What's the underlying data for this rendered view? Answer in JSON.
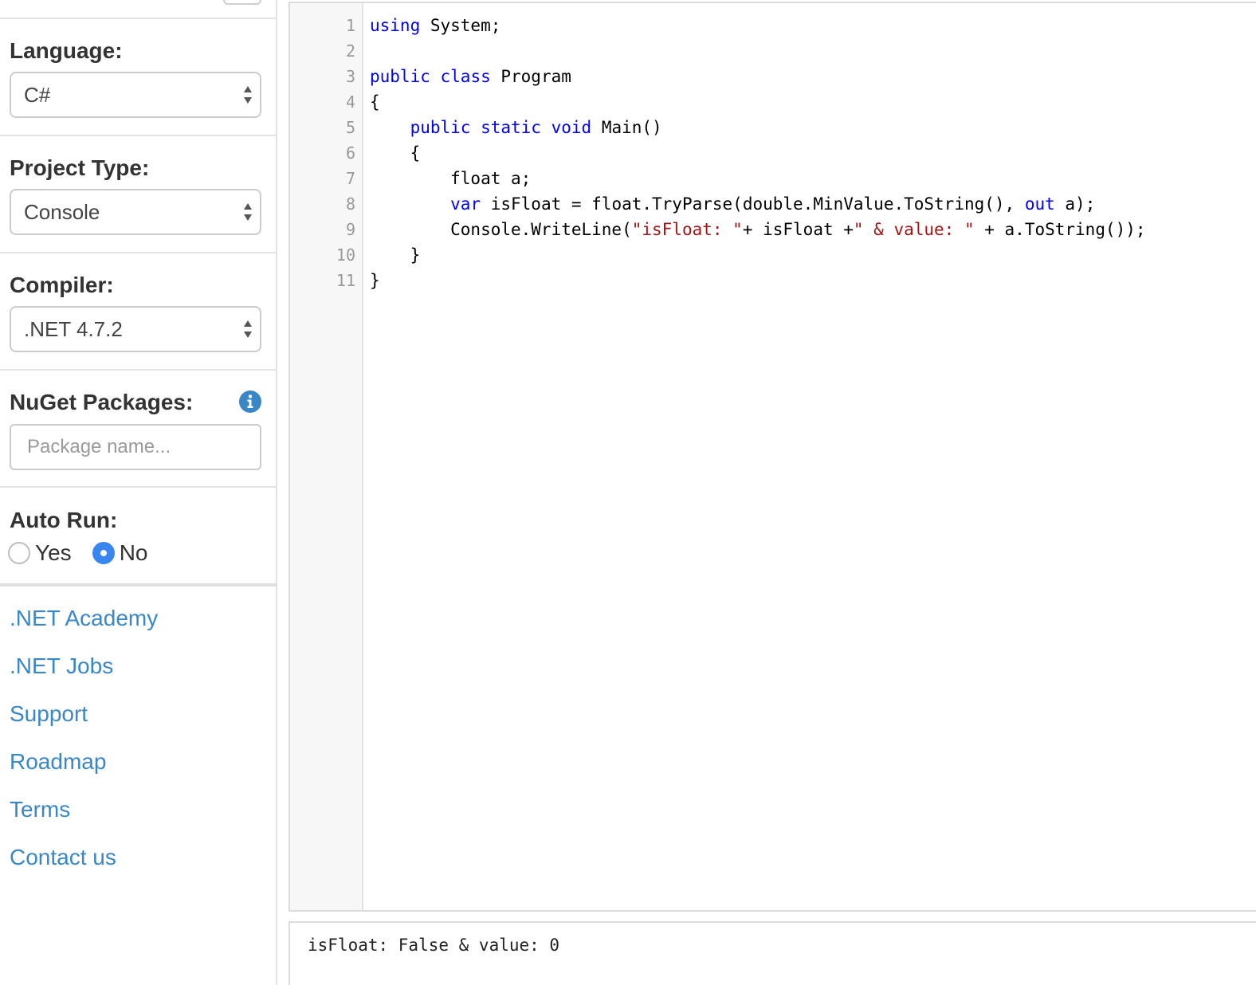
{
  "sidebar": {
    "language": {
      "label": "Language:",
      "value": "C#"
    },
    "project_type": {
      "label": "Project Type:",
      "value": "Console"
    },
    "compiler": {
      "label": "Compiler:",
      "value": ".NET 4.7.2"
    },
    "nuget": {
      "label": "NuGet Packages:",
      "placeholder": "Package name...",
      "value": ""
    },
    "auto_run": {
      "label": "Auto Run:",
      "options": [
        {
          "label": "Yes",
          "checked": false
        },
        {
          "label": "No",
          "checked": true
        }
      ]
    },
    "links": [
      ".NET Academy",
      ".NET Jobs",
      "Support",
      "Roadmap",
      "Terms",
      "Contact us"
    ]
  },
  "editor": {
    "line_numbers": [
      "1",
      "2",
      "3",
      "4",
      "5",
      "6",
      "7",
      "8",
      "9",
      "10",
      "11"
    ],
    "lines": [
      [
        {
          "t": "using",
          "k": "kw"
        },
        {
          "t": " System;",
          "k": ""
        }
      ],
      [],
      [
        {
          "t": "public",
          "k": "kw"
        },
        {
          "t": " ",
          "k": ""
        },
        {
          "t": "class",
          "k": "kw"
        },
        {
          "t": " Program",
          "k": ""
        }
      ],
      [
        {
          "t": "{",
          "k": ""
        }
      ],
      [
        {
          "t": "    ",
          "k": ""
        },
        {
          "t": "public",
          "k": "kw"
        },
        {
          "t": " ",
          "k": ""
        },
        {
          "t": "static",
          "k": "kw"
        },
        {
          "t": " ",
          "k": ""
        },
        {
          "t": "void",
          "k": "kw"
        },
        {
          "t": " Main()",
          "k": ""
        }
      ],
      [
        {
          "t": "    {",
          "k": ""
        }
      ],
      [
        {
          "t": "        float a;",
          "k": ""
        }
      ],
      [
        {
          "t": "        ",
          "k": ""
        },
        {
          "t": "var",
          "k": "kw"
        },
        {
          "t": " isFloat = float.TryParse(double.MinValue.ToString(), ",
          "k": ""
        },
        {
          "t": "out",
          "k": "kw"
        },
        {
          "t": " a);",
          "k": ""
        }
      ],
      [
        {
          "t": "        Console.WriteLine(",
          "k": ""
        },
        {
          "t": "\"isFloat: \"",
          "k": "str"
        },
        {
          "t": "+ isFloat +",
          "k": ""
        },
        {
          "t": "\" & value: \"",
          "k": "str"
        },
        {
          "t": " + a.ToString());",
          "k": ""
        }
      ],
      [
        {
          "t": "    }",
          "k": ""
        }
      ],
      [
        {
          "t": "}",
          "k": ""
        }
      ]
    ]
  },
  "output": {
    "text": "isFloat: False & value: 0"
  },
  "colors": {
    "keyword": "#0000ff",
    "string": "#a31515",
    "link": "#3a87c8",
    "radio_checked": "#3a86f0",
    "info_icon": "#3a87c8"
  }
}
